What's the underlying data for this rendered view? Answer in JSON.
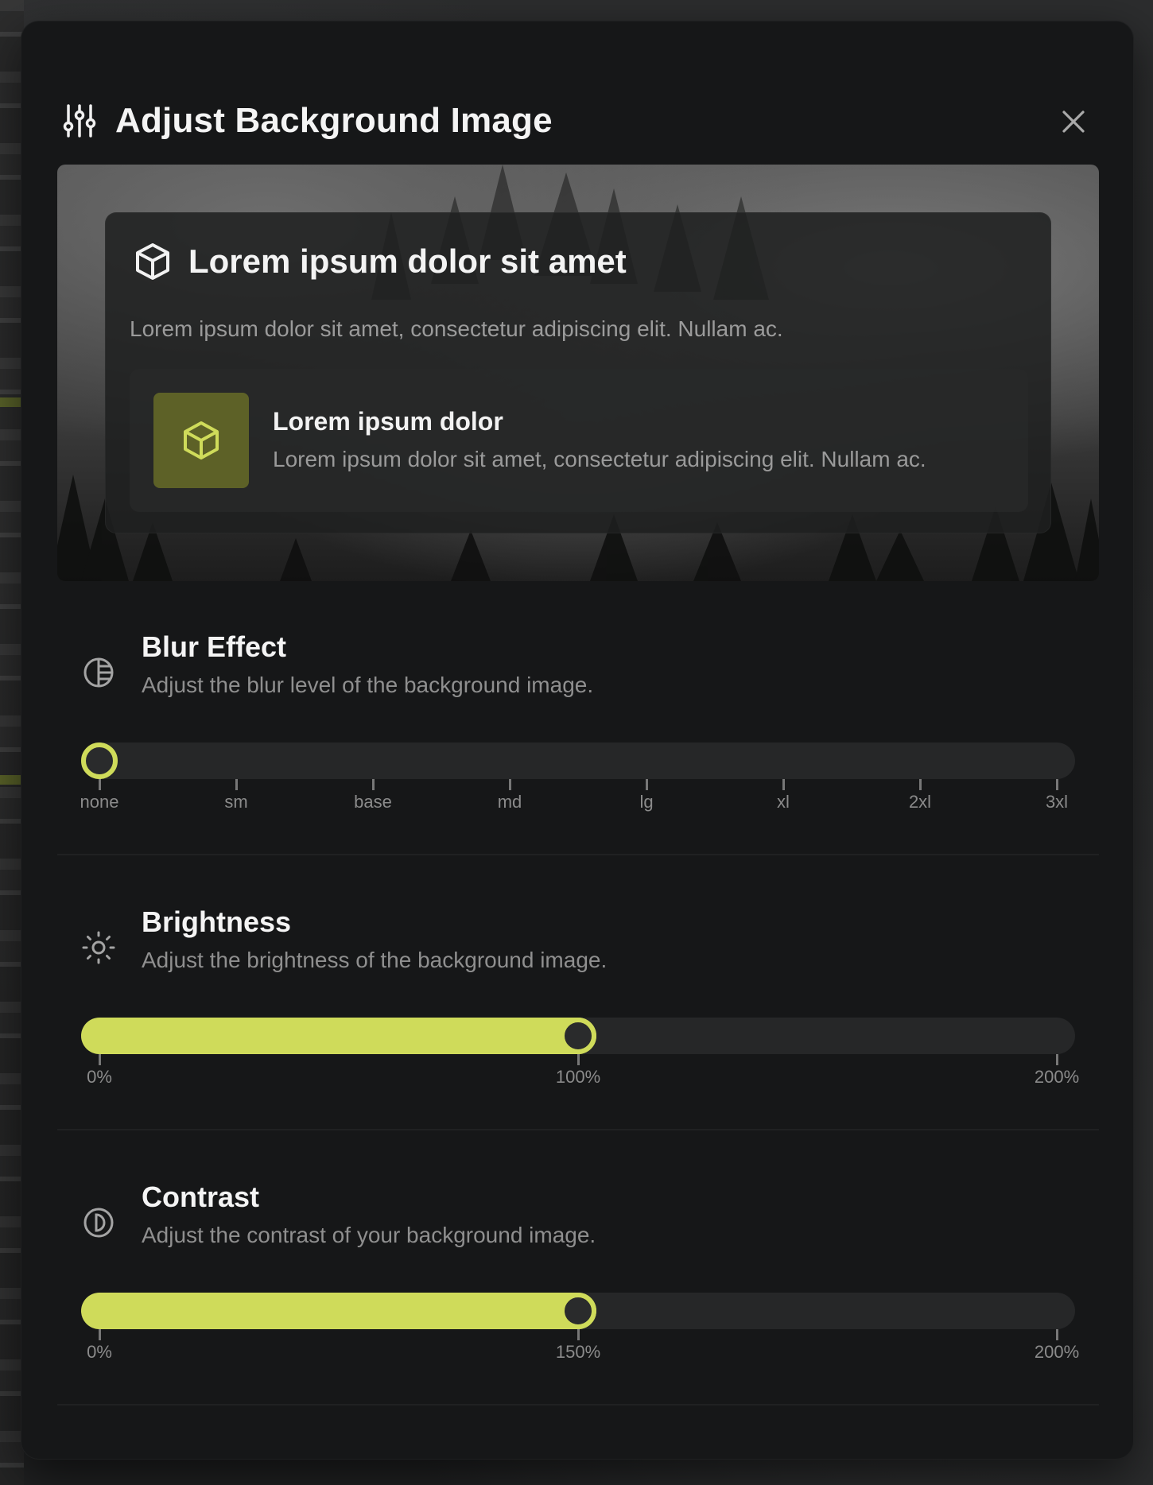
{
  "modal": {
    "title": "Adjust Background Image",
    "header_icon": "sliders-icon",
    "close_icon": "close-icon"
  },
  "preview": {
    "card": {
      "icon": "cube-icon",
      "title": "Lorem ipsum dolor sit amet",
      "description": "Lorem ipsum dolor sit amet, consectetur adipiscing elit. Nullam ac."
    },
    "item": {
      "icon": "cube-icon",
      "title": "Lorem ipsum dolor",
      "description": "Lorem ipsum dolor sit amet, consectetur adipiscing elit. Nullam ac."
    }
  },
  "blur": {
    "icon": "blur-icon",
    "title": "Blur Effect",
    "description": "Adjust the blur level of the background image.",
    "value_index": 0,
    "ticks": [
      "none",
      "sm",
      "base",
      "md",
      "lg",
      "xl",
      "2xl",
      "3xl"
    ]
  },
  "brightness": {
    "icon": "sun-icon",
    "title": "Brightness",
    "description": "Adjust the brightness of the background image.",
    "value_fraction": 0.5,
    "ticks": [
      "0%",
      "100%",
      "200%"
    ]
  },
  "contrast": {
    "icon": "contrast-icon",
    "title": "Contrast",
    "description": "Adjust the contrast of your background image.",
    "value_fraction": 0.5,
    "ticks": [
      "0%",
      "150%",
      "200%"
    ]
  },
  "colors": {
    "accent": "#cfdb5a",
    "panel": "#161718",
    "track": "#262728"
  }
}
